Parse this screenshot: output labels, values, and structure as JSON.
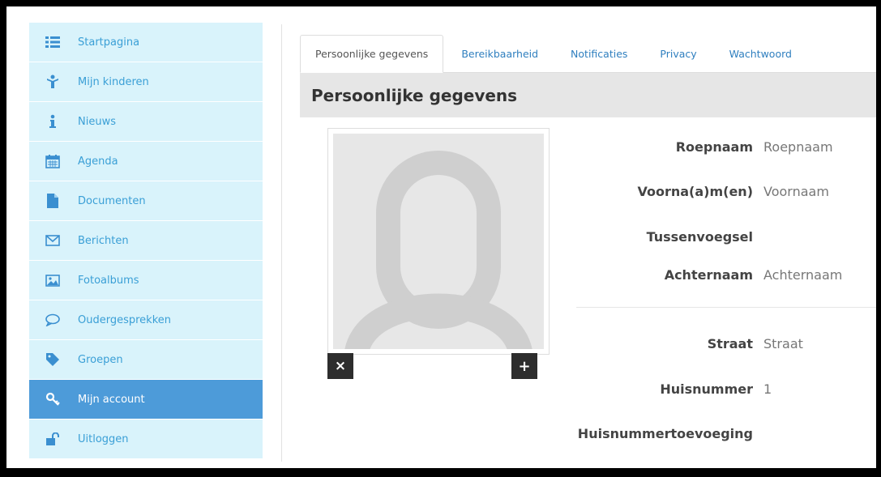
{
  "sidebar": {
    "items": [
      {
        "label": "Startpagina",
        "icon": "list-icon",
        "active": false
      },
      {
        "label": "Mijn kinderen",
        "icon": "child-icon",
        "active": false
      },
      {
        "label": "Nieuws",
        "icon": "info-icon",
        "active": false
      },
      {
        "label": "Agenda",
        "icon": "calendar-icon",
        "active": false
      },
      {
        "label": "Documenten",
        "icon": "document-icon",
        "active": false
      },
      {
        "label": "Berichten",
        "icon": "envelope-icon",
        "active": false
      },
      {
        "label": "Fotoalbums",
        "icon": "picture-icon",
        "active": false
      },
      {
        "label": "Oudergesprekken",
        "icon": "chat-icon",
        "active": false
      },
      {
        "label": "Groepen",
        "icon": "tag-icon",
        "active": false
      },
      {
        "label": "Mijn account",
        "icon": "key-icon",
        "active": true
      },
      {
        "label": "Uitloggen",
        "icon": "unlock-icon",
        "active": false
      }
    ]
  },
  "tabs": [
    {
      "label": "Persoonlijke gegevens",
      "active": true
    },
    {
      "label": "Bereikbaarheid",
      "active": false
    },
    {
      "label": "Notificaties",
      "active": false
    },
    {
      "label": "Privacy",
      "active": false
    },
    {
      "label": "Wachtwoord",
      "active": false
    }
  ],
  "section_title": "Persoonlijke gegevens",
  "photo": {
    "remove_label": "×",
    "add_label": "+"
  },
  "form": {
    "roepnaam": {
      "label": "Roepnaam",
      "value": "Roepnaam"
    },
    "voornamen": {
      "label": "Voorna(a)m(en)",
      "value": "Voornaam"
    },
    "tussenvoegsel": {
      "label": "Tussenvoegsel",
      "value": ""
    },
    "achternaam": {
      "label": "Achternaam",
      "value": "Achternaam"
    },
    "straat": {
      "label": "Straat",
      "value": "Straat"
    },
    "huisnummer": {
      "label": "Huisnummer",
      "value": "1"
    },
    "huisnummertoevoeging": {
      "label": "Huisnummertoevoeging",
      "value": ""
    }
  },
  "colors": {
    "sidebar_bg": "#d9f3fb",
    "sidebar_active": "#4d9bd9",
    "link": "#2f7fbf"
  }
}
